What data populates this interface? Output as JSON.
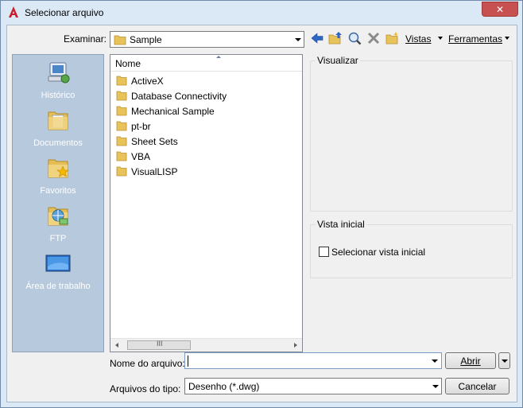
{
  "window": {
    "title": "Selecionar arquivo",
    "close_glyph": "✕"
  },
  "toolbar": {
    "look_in_label": "Examinar:",
    "look_in_value": "Sample",
    "views_label": "Vistas",
    "tools_label": "Ferramentas",
    "icons": [
      "back-icon",
      "up-folder-icon",
      "search-web-icon",
      "delete-icon",
      "new-folder-icon"
    ]
  },
  "places": [
    {
      "label": "Histórico",
      "icon": "history-icon"
    },
    {
      "label": "Documentos",
      "icon": "documents-icon"
    },
    {
      "label": "Favoritos",
      "icon": "favorites-icon"
    },
    {
      "label": "FTP",
      "icon": "ftp-icon"
    },
    {
      "label": "Área de trabalho",
      "icon": "desktop-icon"
    }
  ],
  "file_list": {
    "column_name": "Nome",
    "items": [
      "ActiveX",
      "Database Connectivity",
      "Mechanical Sample",
      "pt-br",
      "Sheet Sets",
      "VBA",
      "VisualLISP"
    ],
    "scroll_grip": "III"
  },
  "preview": {
    "title": "Visualizar"
  },
  "initial_view": {
    "title": "Vista inicial",
    "checkbox_label": "Selecionar vista inicial",
    "checked": false
  },
  "footer": {
    "filename_label": "Nome do arquivo:",
    "filename_value": "",
    "filetype_label": "Arquivos do tipo:",
    "filetype_value": "Desenho (*.dwg)",
    "open_button": "Abrir",
    "cancel_button": "Cancelar"
  },
  "colors": {
    "accent": "#1e4f9c",
    "folder": "#e8c35a",
    "places_bg": "#b7c9dc",
    "close_bg": "#c75050"
  }
}
